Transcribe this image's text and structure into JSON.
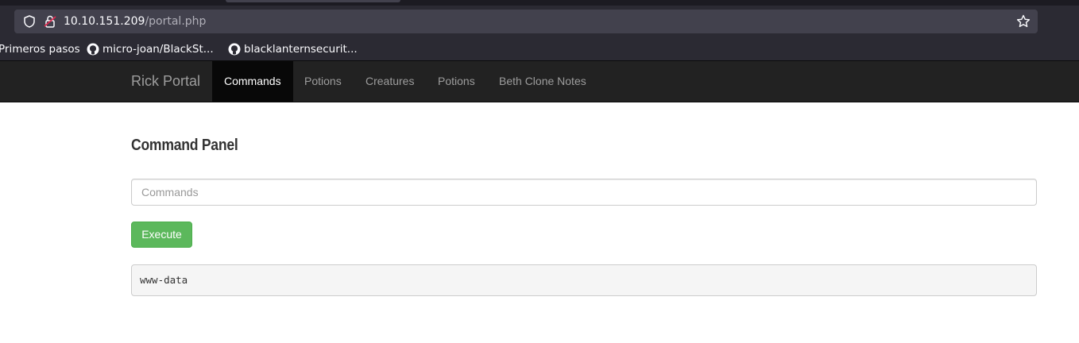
{
  "browser": {
    "url_host": "10.10.151.209",
    "url_path": "/portal.php",
    "bookmarks": [
      {
        "label": "Primeros pasos",
        "icon": null
      },
      {
        "label": "micro-joan/BlackSt...",
        "icon": "github-icon"
      },
      {
        "label": "blacklanternsecurit...",
        "icon": "github-icon"
      }
    ]
  },
  "site": {
    "brand": "Rick Portal",
    "nav": [
      "Commands",
      "Potions",
      "Creatures",
      "Potions",
      "Beth Clone Notes"
    ],
    "active_nav": "Commands"
  },
  "main": {
    "title": "Command Panel",
    "input_placeholder": "Commands",
    "input_value": "",
    "execute_label": "Execute",
    "output": "www-data"
  },
  "colors": {
    "navbar_bg": "#222222",
    "active_nav_bg": "#080808",
    "button_success": "#5cb85c",
    "output_bg": "#f5f5f5"
  }
}
